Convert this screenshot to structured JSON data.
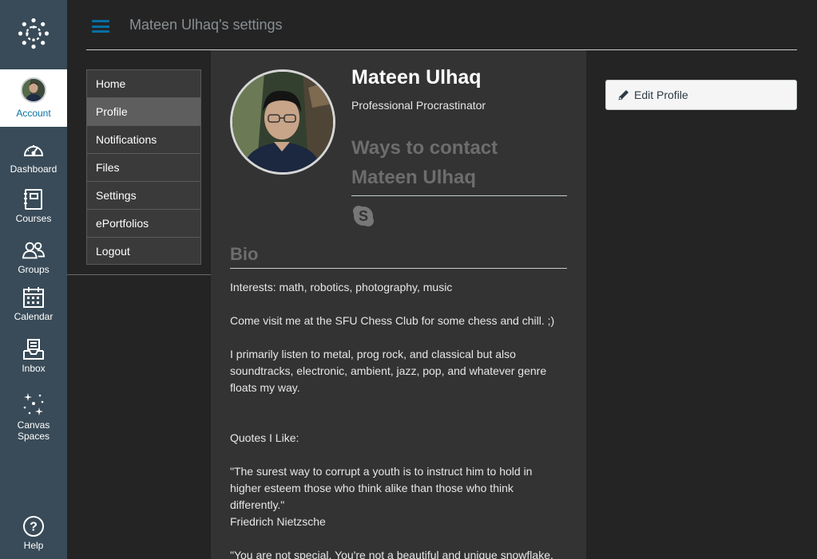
{
  "global_nav": {
    "account": "Account",
    "dashboard": "Dashboard",
    "courses": "Courses",
    "groups": "Groups",
    "calendar": "Calendar",
    "inbox": "Inbox",
    "spaces_line1": "Canvas",
    "spaces_line2": "Spaces",
    "help": "Help",
    "icons": [
      "canvas-logo-icon",
      "avatar",
      "dashboard-icon",
      "courses-icon",
      "groups-icon",
      "calendar-icon",
      "inbox-icon",
      "spaces-icon",
      "help-icon"
    ]
  },
  "header": {
    "breadcrumb": "Mateen Ulhaq's settings"
  },
  "section_nav": {
    "items": [
      "Home",
      "Profile",
      "Notifications",
      "Files",
      "Settings",
      "ePortfolios",
      "Logout"
    ],
    "active": "Profile"
  },
  "profile": {
    "name": "Mateen Ulhaq",
    "title": "Professional Procrastinator",
    "contact_heading": "Ways to contact Mateen Ulhaq",
    "contact_icons": [
      "skype-icon"
    ],
    "bio_heading": "Bio",
    "bio": {
      "interests": "Interests: math, robotics, photography, music",
      "chess": "Come visit me at the SFU Chess Club for some chess and chill. ;)",
      "music": "I primarily listen to metal, prog rock, and classical but also soundtracks, electronic, ambient, jazz, pop, and whatever genre floats my way.",
      "quotes_label": "Quotes I Like:",
      "quote1": "\"The surest way to corrupt a youth is to instruct him to hold in higher esteem those who think alike than those who think differently.\"",
      "quote1_author": "Friedrich Nietzsche",
      "quote2": "\"You are not special. You're not a beautiful and unique snowflake."
    }
  },
  "actions": {
    "edit_profile": "Edit Profile"
  },
  "colors": {
    "nav_bg": "#394b58",
    "page_bg": "#242424",
    "content_bg": "#333333",
    "accent": "#0770a3"
  }
}
